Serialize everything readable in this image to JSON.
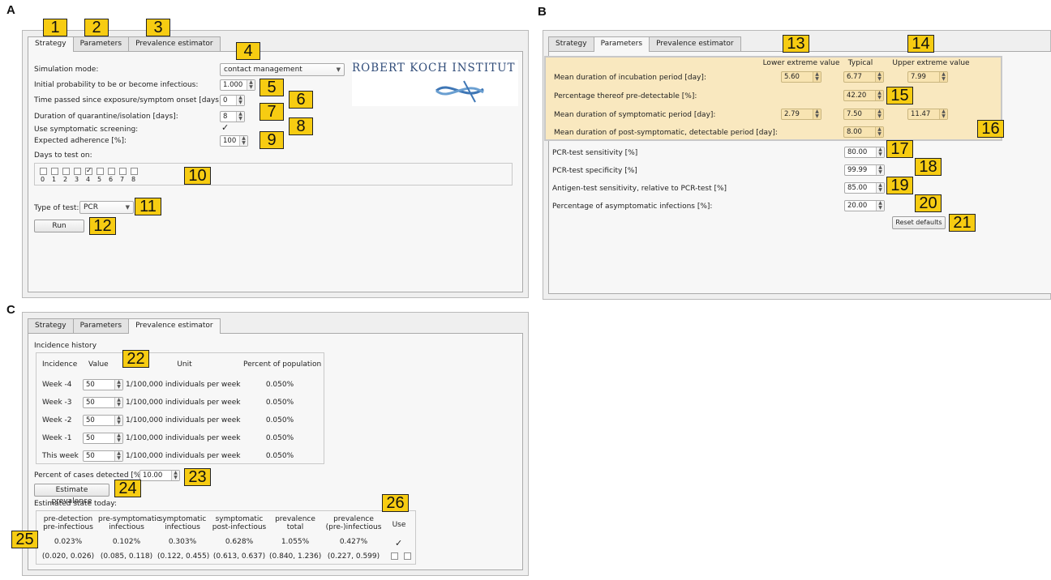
{
  "panel_labels": {
    "a": "A",
    "b": "B",
    "c": "C"
  },
  "tabs": {
    "strategy": "Strategy",
    "parameters": "Parameters",
    "prevalence": "Prevalence estimator"
  },
  "badges": [
    "1",
    "2",
    "3",
    "4",
    "5",
    "6",
    "7",
    "8",
    "9",
    "10",
    "11",
    "12",
    "13",
    "14",
    "15",
    "16",
    "17",
    "18",
    "19",
    "20",
    "21",
    "22",
    "23",
    "24",
    "25",
    "26"
  ],
  "strategy": {
    "simulation_mode_label": "Simulation mode:",
    "simulation_mode_value": "contact management",
    "initial_probability_label": "Initial probability to be or become infectious:",
    "initial_probability_value": "1.000",
    "time_passed_label": "Time passed since exposure/symptom onset [days]:",
    "time_passed_value": "0",
    "duration_label": "Duration of quarantine/isolation [days]:",
    "duration_value": "8",
    "symptomatic_label": "Use symptomatic screening:",
    "symptomatic_check": "✓",
    "adherence_label": "Expected adherence [%]:",
    "adherence_value": "100",
    "days_label": "Days to test on:",
    "days": [
      "0",
      "1",
      "2",
      "3",
      "4",
      "5",
      "6",
      "7",
      "8"
    ],
    "day_check": "✓",
    "test_type_label": "Type of test:",
    "test_type_value": "PCR",
    "run_label": "Run",
    "logo_text": "ROBERT KOCH INSTITUT"
  },
  "parameters": {
    "headers": {
      "lower": "Lower extreme value",
      "typical": "Typical",
      "upper": "Upper extreme value"
    },
    "incubation_label": "Mean duration of incubation period [day]:",
    "incubation_lower": "5.60",
    "incubation_typical": "6.77",
    "incubation_upper": "7.99",
    "predetectable_label": "Percentage thereof pre-detectable [%]:",
    "predetectable_typical": "42.20",
    "symptomatic_label": "Mean duration of symptomatic period [day]:",
    "symptomatic_lower": "2.79",
    "symptomatic_typical": "7.50",
    "symptomatic_upper": "11.47",
    "postsymptomatic_label": "Mean duration of post-symptomatic, detectable period [day]:",
    "postsymptomatic_typical": "8.00",
    "pcr_sensitivity_label": "PCR-test sensitivity [%]",
    "pcr_sensitivity_value": "80.00",
    "pcr_specificity_label": "PCR-test specificity [%]",
    "pcr_specificity_value": "99.99",
    "antigen_label": "Antigen-test sensitivity, relative to PCR-test [%]",
    "antigen_value": "85.00",
    "asymptomatic_label": "Percentage of asymptomatic infections [%]:",
    "asymptomatic_value": "20.00",
    "reset_label": "Reset defaults"
  },
  "prevalence": {
    "incidence_title": "Incidence history",
    "headers": {
      "incidence": "Incidence",
      "value": "Value",
      "unit": "Unit",
      "percent": "Percent of population"
    },
    "rows": [
      {
        "week": "Week -4",
        "value": "50",
        "unit": "1/100,000 individuals per week",
        "percent": "0.050%"
      },
      {
        "week": "Week -3",
        "value": "50",
        "unit": "1/100,000 individuals per week",
        "percent": "0.050%"
      },
      {
        "week": "Week -2",
        "value": "50",
        "unit": "1/100,000 individuals per week",
        "percent": "0.050%"
      },
      {
        "week": "Week -1",
        "value": "50",
        "unit": "1/100,000 individuals per week",
        "percent": "0.050%"
      },
      {
        "week": "This week",
        "value": "50",
        "unit": "1/100,000 individuals per week",
        "percent": "0.050%"
      }
    ],
    "cases_detected_label": "Percent of cases detected [%]",
    "cases_detected_value": "10.00",
    "estimate_label": "Estimate prevalence",
    "state_title": "Estimated state today:",
    "state_headers": [
      {
        "l1": "pre-detection",
        "l2": "pre-infectious"
      },
      {
        "l1": "pre-symptomatic",
        "l2": "infectious"
      },
      {
        "l1": "symptomatic",
        "l2": "infectious"
      },
      {
        "l1": "symptomatic",
        "l2": "post-infectious"
      },
      {
        "l1": "prevalence",
        "l2": "total"
      },
      {
        "l1": "prevalence",
        "l2": "(pre-)infectious"
      }
    ],
    "use_label": "Use",
    "values": [
      "0.023%",
      "0.102%",
      "0.303%",
      "0.628%",
      "1.055%",
      "0.427%"
    ],
    "ranges": [
      "(0.020, 0.026)",
      "(0.085, 0.118)",
      "(0.122, 0.455)",
      "(0.613, 0.637)",
      "(0.840, 1.236)",
      "(0.227, 0.599)"
    ],
    "use_check": "✓"
  }
}
